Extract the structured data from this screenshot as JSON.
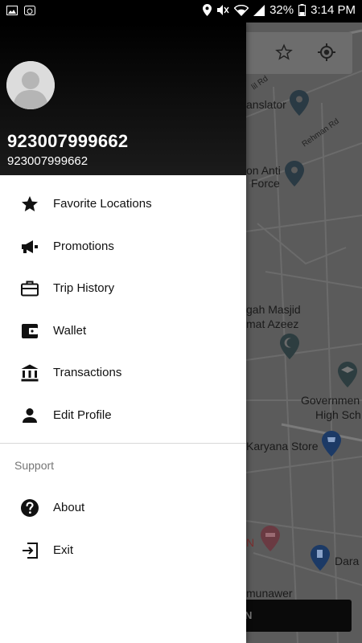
{
  "status_bar": {
    "battery": "32%",
    "time": "3:14 PM"
  },
  "drawer": {
    "user_name": "923007999662",
    "user_phone": "923007999662",
    "menu": [
      {
        "label": "Favorite Locations",
        "icon": "star-icon"
      },
      {
        "label": "Promotions",
        "icon": "megaphone-icon"
      },
      {
        "label": "Trip History",
        "icon": "briefcase-icon"
      },
      {
        "label": "Wallet",
        "icon": "wallet-icon"
      },
      {
        "label": "Transactions",
        "icon": "bank-icon"
      },
      {
        "label": "Edit Profile",
        "icon": "person-icon"
      }
    ],
    "support_title": "Support",
    "support_menu": [
      {
        "label": "About",
        "icon": "help-icon"
      },
      {
        "label": "Exit",
        "icon": "exit-icon"
      }
    ]
  },
  "map": {
    "labels": {
      "translator": "anslator",
      "rehman_rd": "Rehman Rd",
      "anti_force_1": "on Anti",
      "anti_force_2": "Force",
      "masjid_1": "gah Masjid",
      "masjid_2": "mat Azeez",
      "government_1": "Governmen",
      "government_2": "High Sch",
      "karyana": "Karyana Store",
      "dara": "Dara I",
      "munawer": "munawer",
      "n_label": "N",
      "road_small": "lil Rd"
    },
    "bottom_button": "N"
  }
}
